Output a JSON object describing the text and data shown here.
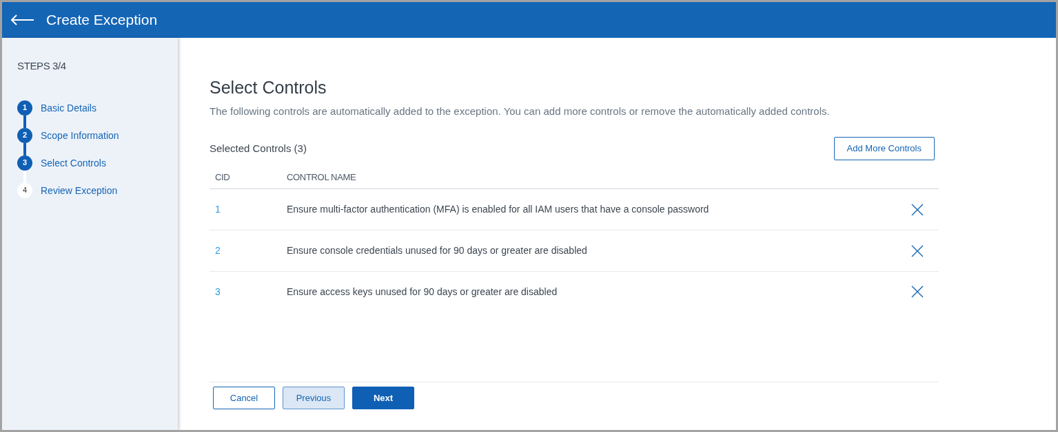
{
  "header": {
    "title": "Create Exception"
  },
  "sidebar": {
    "steps_label": "STEPS 3/4",
    "steps": [
      {
        "number": "1",
        "label": "Basic Details",
        "completed": true
      },
      {
        "number": "2",
        "label": "Scope Information",
        "completed": true
      },
      {
        "number": "3",
        "label": "Select Controls",
        "completed": true
      },
      {
        "number": "4",
        "label": "Review Exception",
        "completed": false
      }
    ]
  },
  "main": {
    "title": "Select Controls",
    "description": "The following controls are automatically added to the exception. You can add more controls or remove the automatically added controls.",
    "selected_label": "Selected Controls (3)",
    "add_button": "Add More Controls",
    "table": {
      "columns": [
        "CID",
        "CONTROL NAME"
      ],
      "rows": [
        {
          "cid": "1",
          "name": "Ensure multi-factor authentication (MFA) is enabled for all IAM users that have a console password"
        },
        {
          "cid": "2",
          "name": "Ensure console credentials unused for 90 days or greater are disabled"
        },
        {
          "cid": "3",
          "name": "Ensure access keys unused for 90 days or greater are disabled"
        }
      ]
    }
  },
  "footer": {
    "buttons": [
      {
        "label": "Cancel",
        "kind": "outline"
      },
      {
        "label": "Previous",
        "kind": "secondary"
      },
      {
        "label": "Next",
        "kind": "primary"
      }
    ]
  }
}
